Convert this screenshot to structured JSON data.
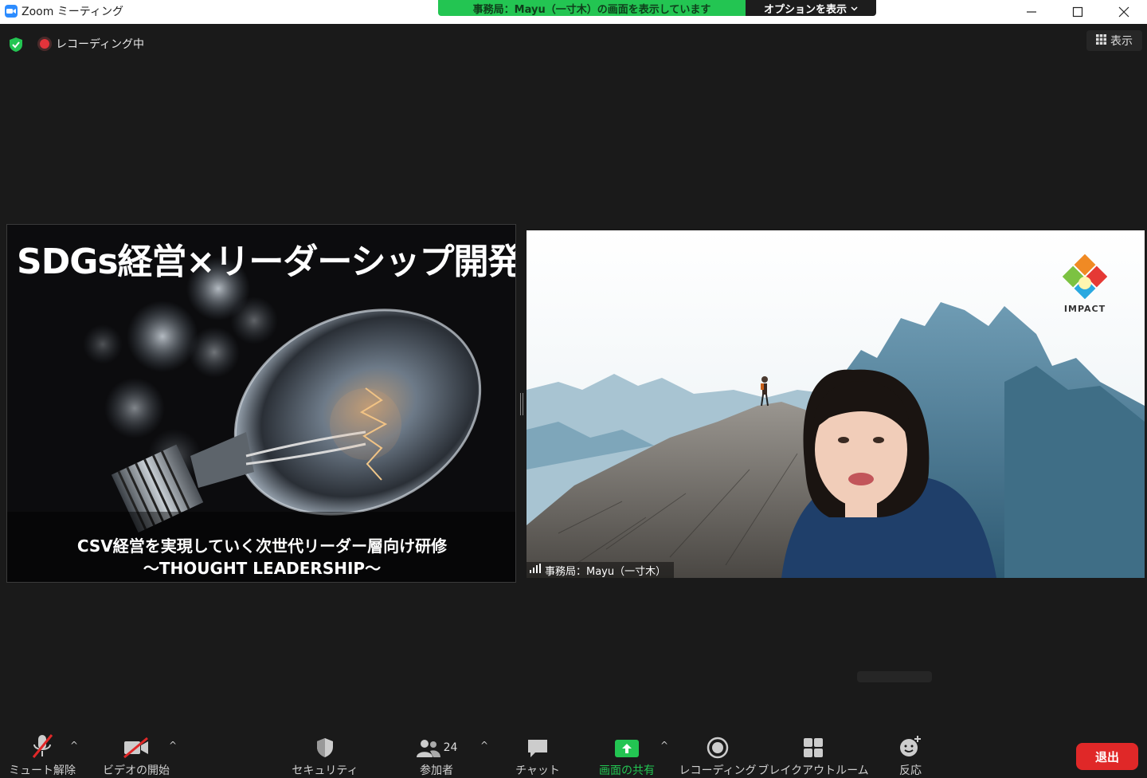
{
  "window": {
    "title": "Zoom ミーティング",
    "share_banner": "事務局：Mayu（一寸木）の画面を表示しています",
    "share_options": "オプションを表示"
  },
  "overlay": {
    "recording_label": "レコーディング中",
    "view_label": "表示"
  },
  "slide": {
    "title": "SDGs経営×リーダーシップ開発",
    "subtitle": "CSV経営を実現していく次世代リーダー層向け研修",
    "subtitle2": "〜THOUGHT LEADERSHIP〜"
  },
  "speaker": {
    "name": "事務局：Mayu（一寸木）",
    "logo_text": "IMPACT"
  },
  "toolbar": {
    "mute_label": "ミュート解除",
    "video_label": "ビデオの開始",
    "security_label": "セキュリティ",
    "participants_label": "参加者",
    "participants_count": "24",
    "chat_label": "チャット",
    "share_label": "画面の共有",
    "record_label": "レコーディング",
    "breakout_label": "ブレイクアウトルーム",
    "reactions_label": "反応",
    "leave_label": "退出"
  },
  "colors": {
    "share_green": "#23c552",
    "leave_red": "#e02828",
    "zoom_blue": "#2d8cff",
    "background": "#1a1a1a"
  }
}
